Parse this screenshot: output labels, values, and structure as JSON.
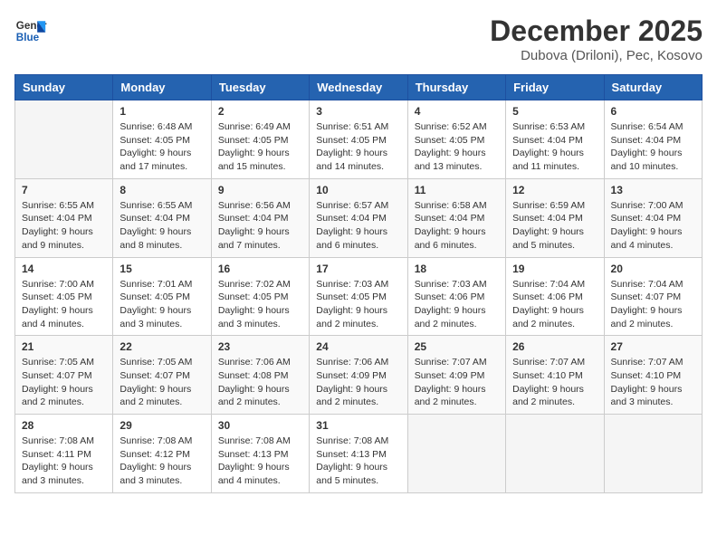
{
  "logo": {
    "line1": "General",
    "line2": "Blue"
  },
  "title": "December 2025",
  "location": "Dubova (Driloni), Pec, Kosovo",
  "days_header": [
    "Sunday",
    "Monday",
    "Tuesday",
    "Wednesday",
    "Thursday",
    "Friday",
    "Saturday"
  ],
  "weeks": [
    [
      {
        "day": "",
        "sunrise": "",
        "sunset": "",
        "daylight": ""
      },
      {
        "day": "1",
        "sunrise": "Sunrise: 6:48 AM",
        "sunset": "Sunset: 4:05 PM",
        "daylight": "Daylight: 9 hours and 17 minutes."
      },
      {
        "day": "2",
        "sunrise": "Sunrise: 6:49 AM",
        "sunset": "Sunset: 4:05 PM",
        "daylight": "Daylight: 9 hours and 15 minutes."
      },
      {
        "day": "3",
        "sunrise": "Sunrise: 6:51 AM",
        "sunset": "Sunset: 4:05 PM",
        "daylight": "Daylight: 9 hours and 14 minutes."
      },
      {
        "day": "4",
        "sunrise": "Sunrise: 6:52 AM",
        "sunset": "Sunset: 4:05 PM",
        "daylight": "Daylight: 9 hours and 13 minutes."
      },
      {
        "day": "5",
        "sunrise": "Sunrise: 6:53 AM",
        "sunset": "Sunset: 4:04 PM",
        "daylight": "Daylight: 9 hours and 11 minutes."
      },
      {
        "day": "6",
        "sunrise": "Sunrise: 6:54 AM",
        "sunset": "Sunset: 4:04 PM",
        "daylight": "Daylight: 9 hours and 10 minutes."
      }
    ],
    [
      {
        "day": "7",
        "sunrise": "Sunrise: 6:55 AM",
        "sunset": "Sunset: 4:04 PM",
        "daylight": "Daylight: 9 hours and 9 minutes."
      },
      {
        "day": "8",
        "sunrise": "Sunrise: 6:55 AM",
        "sunset": "Sunset: 4:04 PM",
        "daylight": "Daylight: 9 hours and 8 minutes."
      },
      {
        "day": "9",
        "sunrise": "Sunrise: 6:56 AM",
        "sunset": "Sunset: 4:04 PM",
        "daylight": "Daylight: 9 hours and 7 minutes."
      },
      {
        "day": "10",
        "sunrise": "Sunrise: 6:57 AM",
        "sunset": "Sunset: 4:04 PM",
        "daylight": "Daylight: 9 hours and 6 minutes."
      },
      {
        "day": "11",
        "sunrise": "Sunrise: 6:58 AM",
        "sunset": "Sunset: 4:04 PM",
        "daylight": "Daylight: 9 hours and 6 minutes."
      },
      {
        "day": "12",
        "sunrise": "Sunrise: 6:59 AM",
        "sunset": "Sunset: 4:04 PM",
        "daylight": "Daylight: 9 hours and 5 minutes."
      },
      {
        "day": "13",
        "sunrise": "Sunrise: 7:00 AM",
        "sunset": "Sunset: 4:04 PM",
        "daylight": "Daylight: 9 hours and 4 minutes."
      }
    ],
    [
      {
        "day": "14",
        "sunrise": "Sunrise: 7:00 AM",
        "sunset": "Sunset: 4:05 PM",
        "daylight": "Daylight: 9 hours and 4 minutes."
      },
      {
        "day": "15",
        "sunrise": "Sunrise: 7:01 AM",
        "sunset": "Sunset: 4:05 PM",
        "daylight": "Daylight: 9 hours and 3 minutes."
      },
      {
        "day": "16",
        "sunrise": "Sunrise: 7:02 AM",
        "sunset": "Sunset: 4:05 PM",
        "daylight": "Daylight: 9 hours and 3 minutes."
      },
      {
        "day": "17",
        "sunrise": "Sunrise: 7:03 AM",
        "sunset": "Sunset: 4:05 PM",
        "daylight": "Daylight: 9 hours and 2 minutes."
      },
      {
        "day": "18",
        "sunrise": "Sunrise: 7:03 AM",
        "sunset": "Sunset: 4:06 PM",
        "daylight": "Daylight: 9 hours and 2 minutes."
      },
      {
        "day": "19",
        "sunrise": "Sunrise: 7:04 AM",
        "sunset": "Sunset: 4:06 PM",
        "daylight": "Daylight: 9 hours and 2 minutes."
      },
      {
        "day": "20",
        "sunrise": "Sunrise: 7:04 AM",
        "sunset": "Sunset: 4:07 PM",
        "daylight": "Daylight: 9 hours and 2 minutes."
      }
    ],
    [
      {
        "day": "21",
        "sunrise": "Sunrise: 7:05 AM",
        "sunset": "Sunset: 4:07 PM",
        "daylight": "Daylight: 9 hours and 2 minutes."
      },
      {
        "day": "22",
        "sunrise": "Sunrise: 7:05 AM",
        "sunset": "Sunset: 4:07 PM",
        "daylight": "Daylight: 9 hours and 2 minutes."
      },
      {
        "day": "23",
        "sunrise": "Sunrise: 7:06 AM",
        "sunset": "Sunset: 4:08 PM",
        "daylight": "Daylight: 9 hours and 2 minutes."
      },
      {
        "day": "24",
        "sunrise": "Sunrise: 7:06 AM",
        "sunset": "Sunset: 4:09 PM",
        "daylight": "Daylight: 9 hours and 2 minutes."
      },
      {
        "day": "25",
        "sunrise": "Sunrise: 7:07 AM",
        "sunset": "Sunset: 4:09 PM",
        "daylight": "Daylight: 9 hours and 2 minutes."
      },
      {
        "day": "26",
        "sunrise": "Sunrise: 7:07 AM",
        "sunset": "Sunset: 4:10 PM",
        "daylight": "Daylight: 9 hours and 2 minutes."
      },
      {
        "day": "27",
        "sunrise": "Sunrise: 7:07 AM",
        "sunset": "Sunset: 4:10 PM",
        "daylight": "Daylight: 9 hours and 3 minutes."
      }
    ],
    [
      {
        "day": "28",
        "sunrise": "Sunrise: 7:08 AM",
        "sunset": "Sunset: 4:11 PM",
        "daylight": "Daylight: 9 hours and 3 minutes."
      },
      {
        "day": "29",
        "sunrise": "Sunrise: 7:08 AM",
        "sunset": "Sunset: 4:12 PM",
        "daylight": "Daylight: 9 hours and 3 minutes."
      },
      {
        "day": "30",
        "sunrise": "Sunrise: 7:08 AM",
        "sunset": "Sunset: 4:13 PM",
        "daylight": "Daylight: 9 hours and 4 minutes."
      },
      {
        "day": "31",
        "sunrise": "Sunrise: 7:08 AM",
        "sunset": "Sunset: 4:13 PM",
        "daylight": "Daylight: 9 hours and 5 minutes."
      },
      {
        "day": "",
        "sunrise": "",
        "sunset": "",
        "daylight": ""
      },
      {
        "day": "",
        "sunrise": "",
        "sunset": "",
        "daylight": ""
      },
      {
        "day": "",
        "sunrise": "",
        "sunset": "",
        "daylight": ""
      }
    ]
  ]
}
